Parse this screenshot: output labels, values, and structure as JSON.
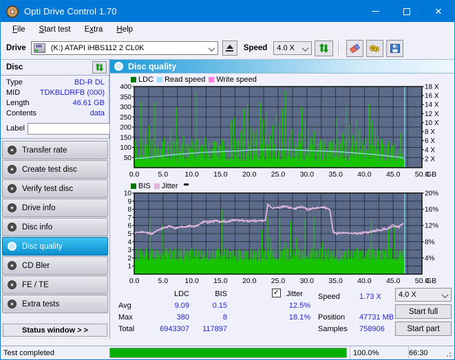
{
  "window": {
    "title": "Opti Drive Control 1.70",
    "icon": "disc-icon",
    "minimize": "minimize-icon",
    "maximize": "maximize-icon",
    "close": "close-icon"
  },
  "menu": {
    "items": [
      {
        "label": "File",
        "accel": "F"
      },
      {
        "label": "Start test",
        "accel": "S"
      },
      {
        "label": "Extra",
        "accel": "E"
      },
      {
        "label": "Help",
        "accel": "H"
      }
    ]
  },
  "toolbar": {
    "drive_label": "Drive",
    "drive_value": "(K:)  ATAPI iHBS112  2 CL0K",
    "drive_icon": "drive-icon",
    "eject_icon": "eject-icon",
    "speed_label": "Speed",
    "speed_value": "4.0 X",
    "refresh_icon": "refresh-icon",
    "erase_icon": "eraser-icon",
    "tools_icon": "tools-icon",
    "save_icon": "save-icon"
  },
  "disc_panel": {
    "title": "Disc",
    "refresh_icon": "refresh-icon",
    "rows": [
      {
        "key": "Type",
        "value": "BD-R DL"
      },
      {
        "key": "MID",
        "value": "TDKBLDRFB (000)"
      },
      {
        "key": "Length",
        "value": "46.61 GB"
      },
      {
        "key": "Contents",
        "value": "data"
      }
    ],
    "label_key": "Label",
    "label_value": "",
    "label_placeholder": "",
    "disc_button_icon": "cd-icon"
  },
  "nav": {
    "items": [
      {
        "label": "Transfer rate",
        "icon": "disc-icon",
        "active": false
      },
      {
        "label": "Create test disc",
        "icon": "disc-icon",
        "active": false
      },
      {
        "label": "Verify test disc",
        "icon": "disc-icon",
        "active": false
      },
      {
        "label": "Drive info",
        "icon": "disc-icon",
        "active": false
      },
      {
        "label": "Disc info",
        "icon": "disc-icon",
        "active": false
      },
      {
        "label": "Disc quality",
        "icon": "disc-icon",
        "active": true
      },
      {
        "label": "CD Bler",
        "icon": "disc-icon",
        "active": false
      },
      {
        "label": "FE / TE",
        "icon": "disc-icon",
        "active": false
      },
      {
        "label": "Extra tests",
        "icon": "disc-icon",
        "active": false
      }
    ],
    "status_window_button": "Status window > >"
  },
  "panel": {
    "title": "Disc quality",
    "icon": "disc-icon"
  },
  "stats": {
    "col_headers": [
      "LDC",
      "BIS"
    ],
    "row_labels": [
      "Avg",
      "Max",
      "Total"
    ],
    "ldc": {
      "avg": "9.09",
      "max": "380",
      "total": "6943307"
    },
    "bis": {
      "avg": "0.15",
      "max": "8",
      "total": "117897"
    },
    "jitter": {
      "label": "Jitter",
      "checked": true,
      "avg": "12.5%",
      "max": "18.1%"
    },
    "speed_label": "Speed",
    "speed_value": "1.73 X",
    "position_label": "Position",
    "position_value": "47731 MB",
    "samples_label": "Samples",
    "samples_value": "758906",
    "speed_select": "4.0 X",
    "start_full": "Start full",
    "start_part": "Start part"
  },
  "statusbar": {
    "message": "Test completed",
    "percent_label": "100.0%",
    "percent_value": 100,
    "time": "66:30"
  },
  "colors": {
    "accent": "#0078d7",
    "value_text": "#2323d6",
    "plot_bg": "#5c6b8a",
    "grid": "#2b3347",
    "ldc_green": "#17c400",
    "bis_green": "#17c400",
    "read_speed": "#9fdcf5",
    "write_speed": "#ff7fdc",
    "jitter": "#e0b6dd",
    "progress": "#00b000"
  },
  "chart_data": [
    {
      "type": "line",
      "name": "disc-quality-ldc-chart",
      "title": "",
      "xlabel": "GB",
      "ylabel": "",
      "xlim": [
        0,
        50
      ],
      "xticks": [
        0.0,
        5.0,
        10.0,
        15.0,
        20.0,
        25.0,
        30.0,
        35.0,
        40.0,
        45.0,
        50.0
      ],
      "xticklabels": [
        "0.0",
        "5.0",
        "10.0",
        "15.0",
        "20.0",
        "25.0",
        "30.0",
        "35.0",
        "40.0",
        "45.0",
        "50.0"
      ],
      "ylim": [
        0,
        400
      ],
      "yticks": [
        50,
        100,
        150,
        200,
        250,
        300,
        350,
        400
      ],
      "yticklabels": [
        "50",
        "100",
        "150",
        "200",
        "250",
        "300",
        "350",
        "400"
      ],
      "y2lim": [
        0,
        18
      ],
      "y2ticks": [
        2,
        4,
        6,
        8,
        10,
        12,
        14,
        16,
        18
      ],
      "y2ticklabels": [
        "2 X",
        "4 X",
        "6 X",
        "8 X",
        "10 X",
        "12 X",
        "14 X",
        "16 X",
        "18 X"
      ],
      "grid": true,
      "legend": [
        {
          "label": "LDC",
          "color": "#007700"
        },
        {
          "label": "Read speed",
          "color": "#9fdcf5"
        },
        {
          "label": "Write speed",
          "color": "#ff7fdc"
        }
      ],
      "series": [
        {
          "name": "LDC",
          "kind": "impulse",
          "color": "#17c400",
          "x_end": 47.0,
          "baseline_band": [
            30,
            60
          ],
          "spikes_x": [
            1.2,
            2.0,
            2.6,
            3.1,
            3.6,
            4.1,
            4.6,
            5.2,
            5.8,
            6.3,
            6.9,
            7.4,
            8.0,
            8.6,
            9.1,
            9.7,
            10.2,
            10.8,
            11.3,
            11.9,
            12.4,
            13.0,
            13.6,
            14.1,
            14.7,
            15.2,
            15.8,
            16.3,
            16.9,
            17.4,
            18.0,
            18.6,
            19.1,
            19.7,
            20.2,
            20.8,
            21.3,
            21.9,
            22.4,
            23.0,
            23.6,
            24.1,
            24.7,
            25.2,
            25.8,
            26.3,
            26.9,
            27.4,
            28.0,
            28.6,
            29.1,
            29.7,
            30.2,
            30.8,
            31.3,
            31.9,
            32.4,
            33.0,
            33.6,
            34.1,
            34.7,
            35.2,
            35.8,
            36.3,
            36.9,
            37.4,
            38.0,
            38.6,
            39.1,
            39.7,
            40.2,
            40.8,
            41.3,
            41.9,
            42.4,
            43.0,
            43.6,
            44.1,
            44.7,
            45.2,
            45.8,
            46.3
          ],
          "spikes_y": [
            325,
            180,
            210,
            140,
            325,
            120,
            95,
            150,
            130,
            190,
            110,
            300,
            100,
            160,
            120,
            90,
            85,
            370,
            140,
            110,
            150,
            125,
            95,
            130,
            115,
            140,
            100,
            120,
            230,
            250,
            150,
            180,
            290,
            310,
            200,
            175,
            190,
            320,
            240,
            280,
            160,
            210,
            265,
            230,
            290,
            380,
            150,
            190,
            130,
            170,
            300,
            240,
            200,
            150,
            180,
            120,
            140,
            110,
            95,
            130,
            140,
            250,
            120,
            170,
            300,
            210,
            160,
            240,
            190,
            130,
            150,
            315,
            230,
            190,
            160,
            140,
            110,
            130,
            100,
            120,
            90,
            170
          ]
        },
        {
          "name": "Read speed",
          "kind": "line",
          "color": "#9fdcf5",
          "x": [
            0.0,
            2.0,
            4.0,
            6.0,
            8.0,
            10.0,
            12.0,
            14.0,
            16.0,
            18.0,
            20.0,
            22.0,
            24.0,
            26.0,
            28.0,
            30.0,
            32.0,
            34.0,
            36.0,
            38.0,
            40.0,
            42.0,
            44.0,
            46.0,
            47.0
          ],
          "y": [
            2.0,
            2.2,
            2.5,
            2.8,
            3.0,
            3.2,
            3.4,
            3.5,
            3.6,
            3.7,
            3.9,
            4.0,
            4.0,
            4.0,
            3.9,
            3.8,
            3.7,
            3.6,
            3.5,
            3.3,
            3.1,
            2.9,
            2.6,
            2.3,
            2.1
          ],
          "axis": "right"
        }
      ]
    },
    {
      "type": "line",
      "name": "disc-quality-bis-jitter-chart",
      "title": "",
      "xlabel": "GB",
      "ylabel": "",
      "xlim": [
        0,
        50
      ],
      "xticks": [
        0.0,
        5.0,
        10.0,
        15.0,
        20.0,
        25.0,
        30.0,
        35.0,
        40.0,
        45.0,
        50.0
      ],
      "xticklabels": [
        "0.0",
        "5.0",
        "10.0",
        "15.0",
        "20.0",
        "25.0",
        "30.0",
        "35.0",
        "40.0",
        "45.0",
        "50.0"
      ],
      "ylim": [
        0,
        10
      ],
      "yticks": [
        1,
        2,
        3,
        4,
        5,
        6,
        7,
        8,
        9,
        10
      ],
      "yticklabels": [
        "1",
        "2",
        "3",
        "4",
        "5",
        "6",
        "7",
        "8",
        "9",
        "10"
      ],
      "y2lim": [
        0,
        20
      ],
      "y2ticks": [
        4,
        8,
        12,
        16,
        20
      ],
      "y2ticklabels": [
        "4%",
        "8%",
        "12%",
        "16%",
        "20%"
      ],
      "grid": true,
      "legend": [
        {
          "label": "BIS",
          "color": "#007700"
        },
        {
          "label": "Jitter",
          "color": "#e0b6dd"
        }
      ],
      "series": [
        {
          "name": "BIS",
          "kind": "impulse",
          "color": "#17c400",
          "x_end": 47.0,
          "baseline_band": [
            1.6,
            2.1
          ],
          "spikes_x": [
            0.8,
            1.4,
            2.1,
            2.7,
            3.1,
            3.4,
            3.9,
            4.4,
            4.9,
            5.4,
            5.8,
            6.2,
            6.7,
            7.2,
            7.7,
            8.2,
            8.7,
            9.2,
            9.7,
            10.2,
            10.7,
            11.2,
            11.7,
            12.2,
            12.7,
            13.2,
            13.7,
            14.2,
            14.7,
            15.2,
            15.7,
            16.2,
            16.7,
            17.2,
            17.7,
            18.2,
            18.7,
            19.2,
            19.7,
            20.2,
            20.7,
            21.2,
            21.7,
            22.2,
            22.7,
            23.2,
            23.7,
            24.2,
            24.7,
            25.2,
            25.7,
            26.2,
            26.7,
            27.2,
            27.7,
            28.2,
            28.7,
            29.2,
            29.7,
            30.2,
            30.7,
            31.2,
            31.7,
            32.2,
            32.7,
            33.2,
            33.7,
            34.2,
            34.7,
            35.2,
            35.7,
            36.2,
            36.7,
            37.2,
            37.7,
            38.2,
            38.7,
            39.2,
            39.7,
            40.2,
            40.7,
            41.2,
            41.7,
            42.2,
            42.7,
            43.2,
            43.7,
            44.2,
            44.7,
            45.2,
            45.7,
            46.2,
            46.7
          ],
          "spikes_y": [
            3.0,
            2.8,
            3.2,
            7.0,
            2.6,
            3.0,
            2.9,
            2.7,
            6.1,
            3.0,
            2.8,
            3.1,
            2.9,
            3.3,
            2.7,
            3.0,
            3.2,
            2.8,
            3.0,
            2.9,
            3.1,
            2.8,
            3.0,
            2.9,
            3.2,
            2.7,
            3.1,
            3.0,
            2.9,
            8.0,
            3.0,
            3.1,
            2.8,
            3.0,
            2.9,
            3.1,
            2.8,
            3.0,
            2.9,
            3.2,
            3.0,
            2.8,
            3.1,
            5.5,
            3.0,
            7.0,
            4.5,
            3.0,
            3.2,
            7.0,
            3.0,
            4.0,
            3.2,
            6.5,
            3.0,
            4.5,
            3.1,
            3.0,
            6.9,
            3.0,
            3.2,
            7.0,
            3.0,
            3.1,
            4.0,
            3.0,
            3.2,
            3.0,
            2.9,
            3.1,
            3.0,
            2.8,
            3.0,
            3.1,
            2.9,
            3.0,
            3.2,
            2.8,
            3.0,
            2.9,
            3.1,
            6.8,
            3.0,
            3.2,
            2.9,
            3.1,
            3.0,
            5.5,
            3.2,
            6.0,
            3.0,
            3.1,
            3.0
          ]
        },
        {
          "name": "Jitter",
          "kind": "line",
          "color": "#e0b6dd",
          "x": [
            0.0,
            1.0,
            2.0,
            3.0,
            4.0,
            5.0,
            6.0,
            7.0,
            8.0,
            9.0,
            10.0,
            11.0,
            12.0,
            13.0,
            14.0,
            15.0,
            16.0,
            17.0,
            18.0,
            19.0,
            20.0,
            21.0,
            22.0,
            22.8,
            23.2,
            24.0,
            25.0,
            26.0,
            27.0,
            28.0,
            29.0,
            30.0,
            31.0,
            32.0,
            33.0,
            34.0,
            34.6,
            35.0,
            36.0,
            37.0,
            38.0,
            39.0,
            40.0,
            41.0,
            42.0,
            43.0,
            44.0,
            45.0,
            46.0,
            46.8
          ],
          "y": [
            5.0,
            5.2,
            5.2,
            5.0,
            5.3,
            5.6,
            5.9,
            5.7,
            5.8,
            5.9,
            5.9,
            6.0,
            6.4,
            6.4,
            6.5,
            6.5,
            6.5,
            6.6,
            6.6,
            6.6,
            6.5,
            6.6,
            6.6,
            6.6,
            8.5,
            8.2,
            8.2,
            8.3,
            8.2,
            8.1,
            8.3,
            8.0,
            8.1,
            8.2,
            8.2,
            8.0,
            5.1,
            5.0,
            5.1,
            5.0,
            5.1,
            5.0,
            5.1,
            5.2,
            5.4,
            5.5,
            5.7,
            6.0,
            5.8,
            6.3
          ],
          "axis": "left"
        }
      ]
    }
  ]
}
